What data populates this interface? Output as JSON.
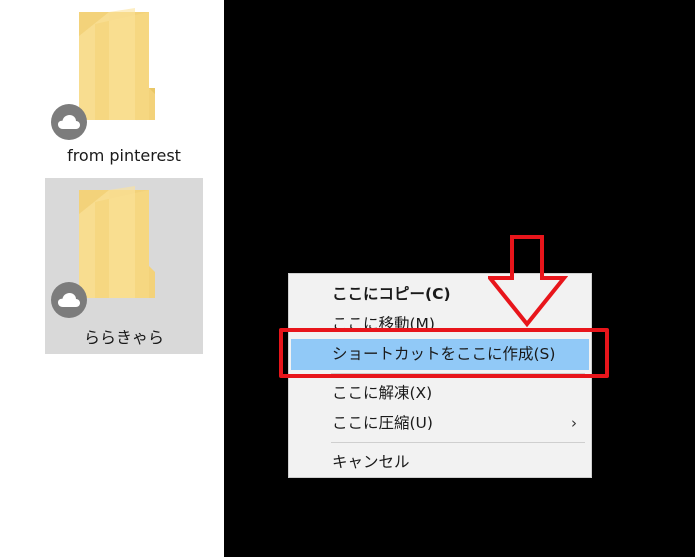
{
  "desktop": {
    "folders": [
      {
        "label": "from pinterest",
        "icon": "folder-icon",
        "badge": "cloud-icon",
        "selected": false
      },
      {
        "label": "ららきゃら",
        "icon": "folder-icon",
        "badge": "cloud-icon",
        "selected": true
      }
    ]
  },
  "context_menu": {
    "items": [
      {
        "label": "ここにコピー(C)",
        "bold": true
      },
      {
        "label": "ここに移動(M)"
      },
      {
        "label": "ショートカットをここに作成(S)",
        "highlighted": true
      },
      {
        "label": "ここに解凍(X)"
      },
      {
        "label": "ここに圧縮(U)",
        "submenu_icon": "chevron-right-icon",
        "submenu_glyph": "›"
      },
      {
        "label": "キャンセル"
      }
    ]
  },
  "annotation": {
    "color": "#e8151b",
    "arrow_icon": "down-arrow-icon"
  }
}
